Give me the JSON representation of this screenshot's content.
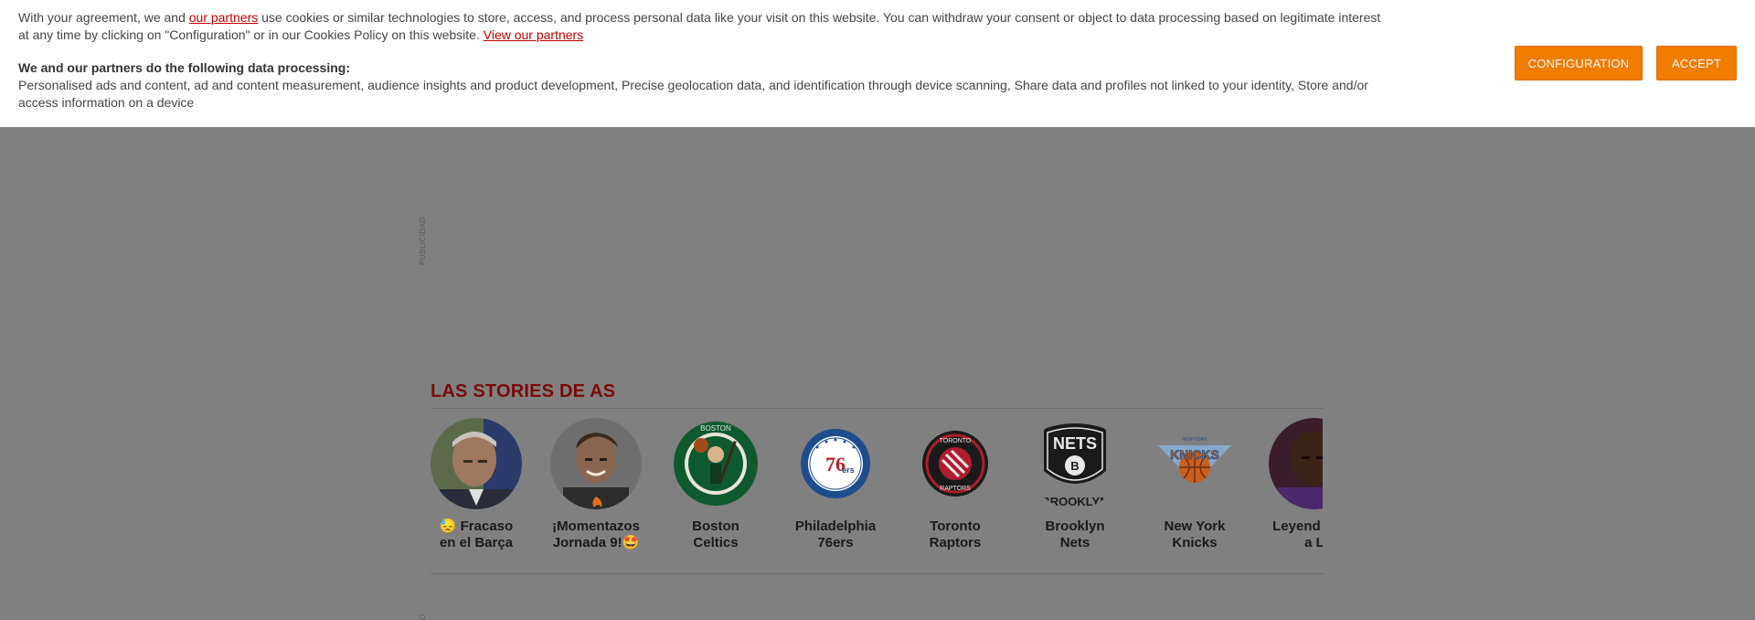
{
  "cookie_banner": {
    "text_before_link": "With your agreement, we and ",
    "partners_link": "our partners",
    "text_after_link": " use cookies or similar technologies to store, access, and process personal data like your visit on this website. You can withdraw your consent or object to data processing based on legitimate interest at any time by clicking on \"Configuration\" or in our Cookies Policy on this website. ",
    "view_partners_link": "View our partners",
    "processing_title": "We and our partners do the following data processing:",
    "processing_list": "Personalised ads and content, ad and content measurement, audience insights and product development, Precise geolocation data, and identification through device scanning, Share data and profiles not linked to your identity, Store and/or access information on a device",
    "configuration_label": "Configuration",
    "accept_label": "Accept",
    "accent_color": "#f07c00"
  },
  "ad_label": "PUBLICIDAD",
  "stories": {
    "title": "LAS STORIES DE AS",
    "items": [
      {
        "label": "😓 Fracaso en el Barça",
        "icon": "person-avatar-icon"
      },
      {
        "label": "¡Momentazos Jornada 9!🤩",
        "icon": "person-avatar-icon"
      },
      {
        "label": "Boston Celtics",
        "icon": "celtics-logo-icon"
      },
      {
        "label": "Philadelphia 76ers",
        "icon": "76ers-logo-icon"
      },
      {
        "label": "Toronto Raptors",
        "icon": "raptors-logo-icon"
      },
      {
        "label": "Brooklyn Nets",
        "icon": "nets-logo-icon"
      },
      {
        "label": "New York Knicks",
        "icon": "knicks-logo-icon"
      },
      {
        "label": "Leyend mate a L",
        "icon": "person-avatar-icon"
      }
    ]
  }
}
